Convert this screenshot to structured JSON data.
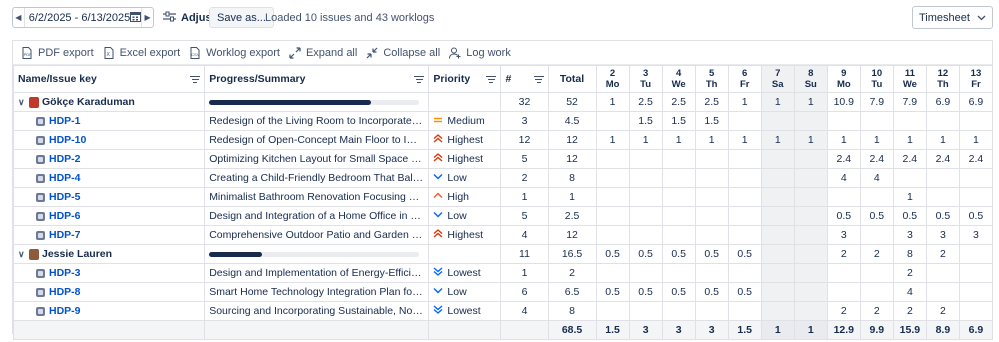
{
  "toolbar": {
    "date_range": "6/2/2025 - 6/13/2025",
    "adjust_label": "Adjust",
    "save_as_label": "Save as...",
    "status_text": "Loaded 10 issues and 43 worklogs",
    "view_select": "Timesheet"
  },
  "actions": {
    "pdf_export": "PDF export",
    "excel_export": "Excel export",
    "worklog_export": "Worklog export",
    "expand_all": "Expand all",
    "collapse_all": "Collapse all",
    "log_work": "Log work"
  },
  "columns": {
    "name": "Name/Issue key",
    "progress": "Progress/Summary",
    "priority": "Priority",
    "count": "#",
    "total": "Total"
  },
  "days": [
    {
      "num": "2",
      "dow": "Mo"
    },
    {
      "num": "3",
      "dow": "Tu"
    },
    {
      "num": "4",
      "dow": "We"
    },
    {
      "num": "5",
      "dow": "Th"
    },
    {
      "num": "6",
      "dow": "Fr"
    },
    {
      "num": "7",
      "dow": "Sa"
    },
    {
      "num": "8",
      "dow": "Su"
    },
    {
      "num": "9",
      "dow": "Mo"
    },
    {
      "num": "10",
      "dow": "Tu"
    },
    {
      "num": "11",
      "dow": "We"
    },
    {
      "num": "12",
      "dow": "Th"
    },
    {
      "num": "13",
      "dow": "Fr"
    }
  ],
  "rows": [
    {
      "type": "user",
      "name": "Gökçe Karaduman",
      "avatar_color": "#c0392b",
      "progress": 0.77,
      "count": "32",
      "total": "52",
      "days": [
        "1",
        "2.5",
        "2.5",
        "2.5",
        "1",
        "1",
        "1",
        "10.9",
        "7.9",
        "7.9",
        "6.9",
        "6.9"
      ]
    },
    {
      "type": "issue",
      "key": "HDP-1",
      "summary": "Redesign of the Living Room to Incorporate a Contemporary Aesthetic",
      "priority": "Medium",
      "priority_icon": "equals-icon",
      "priority_color": "#ff8b00",
      "count": "3",
      "total": "4.5",
      "days": [
        "",
        "1.5",
        "1.5",
        "1.5",
        "",
        "",
        "",
        "",
        "",
        "",
        "",
        ""
      ]
    },
    {
      "type": "issue",
      "key": "HDP-10",
      "summary": "Redesign of Open-Concept Main Floor to Improve Flow, Lighting",
      "priority": "Highest",
      "priority_icon": "double-chevron-up-icon",
      "priority_color": "#de350b",
      "count": "12",
      "total": "12",
      "days": [
        "1",
        "1",
        "1",
        "1",
        "1",
        "1",
        "1",
        "1",
        "1",
        "1",
        "1",
        "1"
      ]
    },
    {
      "type": "issue",
      "key": "HDP-2",
      "summary": "Optimizing Kitchen Layout for Small Space Efficiency and Style",
      "priority": "Highest",
      "priority_icon": "double-chevron-up-icon",
      "priority_color": "#de350b",
      "count": "5",
      "total": "12",
      "days": [
        "",
        "",
        "",
        "",
        "",
        "",
        "",
        "2.4",
        "2.4",
        "2.4",
        "2.4",
        "2.4"
      ]
    },
    {
      "type": "issue",
      "key": "HDP-4",
      "summary": "Creating a Child-Friendly Bedroom That Balances Safety, Fun",
      "priority": "Low",
      "priority_icon": "chevron-down-icon",
      "priority_color": "#0065ff",
      "count": "2",
      "total": "8",
      "days": [
        "",
        "",
        "",
        "",
        "",
        "",
        "",
        "4",
        "4",
        "",
        "",
        ""
      ]
    },
    {
      "type": "issue",
      "key": "HDP-5",
      "summary": "Minimalist Bathroom Renovation Focusing on Clean Lines, Natural Materials",
      "priority": "High",
      "priority_icon": "chevron-up-icon",
      "priority_color": "#ff5630",
      "count": "1",
      "total": "1",
      "days": [
        "",
        "",
        "",
        "",
        "",
        "",
        "",
        "",
        "",
        "1",
        "",
        ""
      ]
    },
    {
      "type": "issue",
      "key": "HDP-6",
      "summary": "Design and Integration of a Home Office in a Multi-Use Living Space",
      "priority": "Low",
      "priority_icon": "chevron-down-icon",
      "priority_color": "#0065ff",
      "count": "5",
      "total": "2.5",
      "days": [
        "",
        "",
        "",
        "",
        "",
        "",
        "",
        "0.5",
        "0.5",
        "0.5",
        "0.5",
        "0.5"
      ]
    },
    {
      "type": "issue",
      "key": "HDP-7",
      "summary": "Comprehensive Outdoor Patio and Garden Design to Extend Living Space",
      "priority": "Highest",
      "priority_icon": "double-chevron-up-icon",
      "priority_color": "#de350b",
      "count": "4",
      "total": "12",
      "days": [
        "",
        "",
        "",
        "",
        "",
        "",
        "",
        "3",
        "",
        "3",
        "3",
        "3"
      ]
    },
    {
      "type": "user",
      "name": "Jessie Lauren",
      "avatar_color": "#8e5a3c",
      "progress": 0.25,
      "count": "11",
      "total": "16.5",
      "days": [
        "0.5",
        "0.5",
        "0.5",
        "0.5",
        "0.5",
        "",
        "",
        "2",
        "2",
        "8",
        "2",
        ""
      ]
    },
    {
      "type": "issue",
      "key": "HDP-3",
      "summary": "Design and Implementation of Energy-Efficient, Layered Lighting",
      "priority": "Lowest",
      "priority_icon": "double-chevron-down-icon",
      "priority_color": "#0065ff",
      "count": "1",
      "total": "2",
      "days": [
        "",
        "",
        "",
        "",
        "",
        "",
        "",
        "",
        "",
        "2",
        "",
        ""
      ]
    },
    {
      "type": "issue",
      "key": "HDP-8",
      "summary": "Smart Home Technology Integration Plan for Security, Comfort",
      "priority": "Low",
      "priority_icon": "chevron-down-icon",
      "priority_color": "#0065ff",
      "count": "6",
      "total": "6.5",
      "days": [
        "0.5",
        "0.5",
        "0.5",
        "0.5",
        "0.5",
        "",
        "",
        "",
        "",
        "4",
        "",
        ""
      ]
    },
    {
      "type": "issue",
      "key": "HDP-9",
      "summary": "Sourcing and Incorporating Sustainable, Non-Toxic Materials",
      "priority": "Lowest",
      "priority_icon": "double-chevron-down-icon",
      "priority_color": "#0065ff",
      "count": "4",
      "total": "8",
      "days": [
        "",
        "",
        "",
        "",
        "",
        "",
        "",
        "2",
        "2",
        "2",
        "2",
        ""
      ]
    }
  ],
  "totals": {
    "total": "68.5",
    "days": [
      "1.5",
      "3",
      "3",
      "3",
      "1.5",
      "1",
      "1",
      "12.9",
      "9.9",
      "15.9",
      "8.9",
      "6.9"
    ]
  }
}
